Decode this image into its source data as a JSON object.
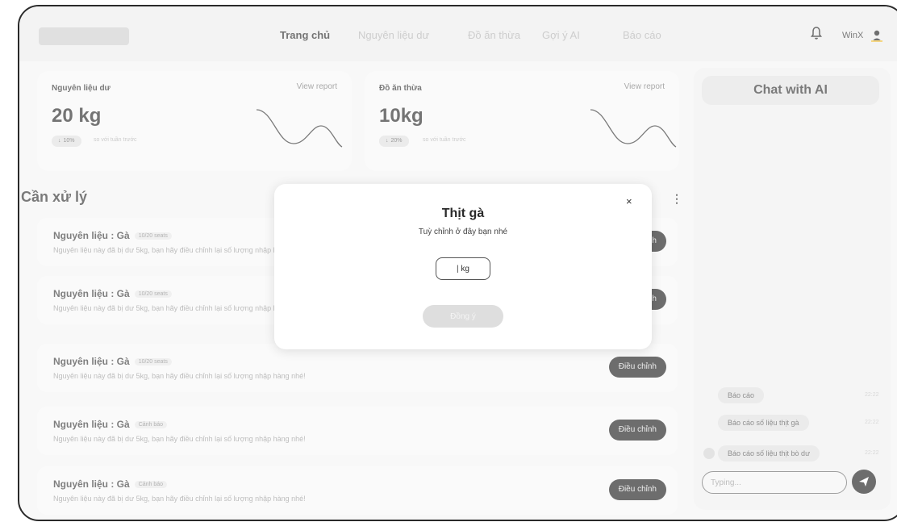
{
  "nav": {
    "items": [
      "Trang chủ",
      "Nguyên liệu dư",
      "Đồ ăn thừa",
      "Gợi ý AI",
      "Báo cáo"
    ],
    "active_index": 0
  },
  "user": {
    "name": "WinX"
  },
  "cards": [
    {
      "title": "Nguyên liệu dư",
      "link": "View report",
      "value": "20 kg",
      "change": "10%",
      "direction": "down",
      "comparison": "so với tuần trước"
    },
    {
      "title": "Đồ ăn thừa",
      "link": "View report",
      "value": "10kg",
      "change": "20%",
      "direction": "down",
      "comparison": "so với tuần trước"
    }
  ],
  "section": {
    "title": "Cần xử lý"
  },
  "tasks": [
    {
      "title": "Nguyên liệu : Gà",
      "tag": "10/20 seats",
      "desc": "Nguyên liệu này đã bị dư 5kg, bạn hãy điều chỉnh lại số lượng nhập hàng nhé!",
      "button": "Điều chỉnh"
    },
    {
      "title": "Nguyên liệu : Gà",
      "tag": "10/20 seats",
      "desc": "Nguyên liệu này đã bị dư 5kg, bạn hãy điều chỉnh lại số lượng nhập hàng nhé!",
      "button": "Điều chỉnh"
    },
    {
      "title": "Nguyên liệu : Gà",
      "tag": "10/20 seats",
      "desc": "Nguyên liệu này đã bị dư 5kg, bạn hãy điều chỉnh lại số lượng nhập hàng nhé!",
      "button": "Điều chỉnh"
    },
    {
      "title": "Nguyên liệu : Gà",
      "tag": "Cảnh báo",
      "desc": "Nguyên liệu này đã bị dư 5kg, bạn hãy điều chỉnh lại số lượng nhập hàng nhé!",
      "button": "Điều chỉnh"
    },
    {
      "title": "Nguyên liệu : Gà",
      "tag": "Cảnh báo",
      "desc": "Nguyên liệu này đã bị dư 5kg, bạn hãy điều chỉnh lại số lượng nhập hàng nhé!",
      "button": "Điều chỉnh"
    }
  ],
  "chat": {
    "title": "Chat with AI",
    "messages": [
      {
        "text": "Báo cáo",
        "time": "22:22"
      },
      {
        "text": "Báo cáo số liệu thịt gà",
        "time": "22:22"
      },
      {
        "text": "Báo cáo số liệu thịt bò dư",
        "time": "22:22"
      }
    ],
    "input_placeholder": "Typing..."
  },
  "modal": {
    "title": "Thịt gà",
    "subtitle": "Tuỳ chỉnh ở đây bạn nhé",
    "input_value": "| kg",
    "confirm": "Đồng ý",
    "close": "×"
  },
  "icons": {
    "bell": "bell-icon",
    "user": "user-icon",
    "send": "send-icon",
    "close": "close-icon",
    "more": "more-vertical-icon",
    "arrow_down": "arrow-down-icon"
  },
  "colors": {
    "dark_button": "#1f1f1f",
    "background": "#f4f4f4"
  }
}
